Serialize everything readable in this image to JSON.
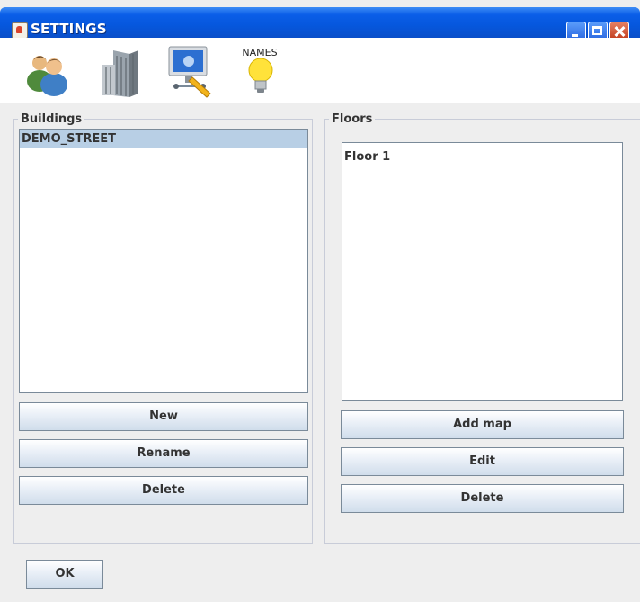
{
  "window": {
    "title": "SETTINGS"
  },
  "toolbar": {
    "items": [
      {
        "icon": "users-icon"
      },
      {
        "icon": "building-icon"
      },
      {
        "icon": "network-computer-icon"
      },
      {
        "icon": "lightbulb-icon",
        "label": "NAMES"
      }
    ]
  },
  "buildings": {
    "label": "Buildings",
    "items": [
      "DEMO_STREET"
    ],
    "selected": "DEMO_STREET",
    "new_label": "New",
    "rename_label": "Rename",
    "delete_label": "Delete"
  },
  "floors": {
    "label": "Floors",
    "items": [
      "Floor 1"
    ],
    "add_map_label": "Add map",
    "edit_label": "Edit",
    "delete_label": "Delete"
  },
  "footer": {
    "ok_label": "OK"
  },
  "colors": {
    "titlebar": "#0a5ee8",
    "selection": "#b8cfe5",
    "close_button": "#c1391a"
  }
}
